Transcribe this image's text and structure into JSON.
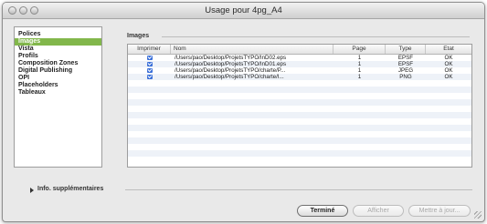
{
  "window": {
    "title": "Usage pour 4pg_A4"
  },
  "sidebar": {
    "items": [
      {
        "label": "Polices",
        "selected": false
      },
      {
        "label": "Images",
        "selected": true
      },
      {
        "label": "Vista",
        "selected": false
      },
      {
        "label": "Profils",
        "selected": false
      },
      {
        "label": "Composition Zones",
        "selected": false
      },
      {
        "label": "Digital Publishing",
        "selected": false
      },
      {
        "label": "OPI",
        "selected": false
      },
      {
        "label": "Placeholders",
        "selected": false
      },
      {
        "label": "Tableaux",
        "selected": false
      }
    ]
  },
  "section": {
    "label": "Images"
  },
  "table": {
    "columns": [
      "Imprimer",
      "Nom",
      "Page",
      "Type",
      "Etat"
    ],
    "rows": [
      {
        "print": true,
        "name": "/Users/pao/Desktop/ProjetsTYPO/InD02.eps",
        "page": "1",
        "type": "EPSF",
        "status": "OK"
      },
      {
        "print": true,
        "name": "/Users/pao/Desktop/ProjetsTYPO/InD01.eps",
        "page": "1",
        "type": "EPSF",
        "status": "OK"
      },
      {
        "print": true,
        "name": "/Users/pao/Desktop/ProjetsTYPO/charte/P...",
        "page": "1",
        "type": "JPEG",
        "status": "OK"
      },
      {
        "print": true,
        "name": "/Users/pao/Desktop/ProjetsTYPO/charte/I...",
        "page": "1",
        "type": "PNG",
        "status": "OK"
      }
    ]
  },
  "extra": {
    "label": "Info. supplémentaires"
  },
  "buttons": {
    "done": "Terminé",
    "show": "Afficher",
    "update": "Mettre à jour..."
  },
  "colors": {
    "selection": "#82b74b",
    "checkbox": "#3a6fd8",
    "zebra": "#eef2f8"
  }
}
